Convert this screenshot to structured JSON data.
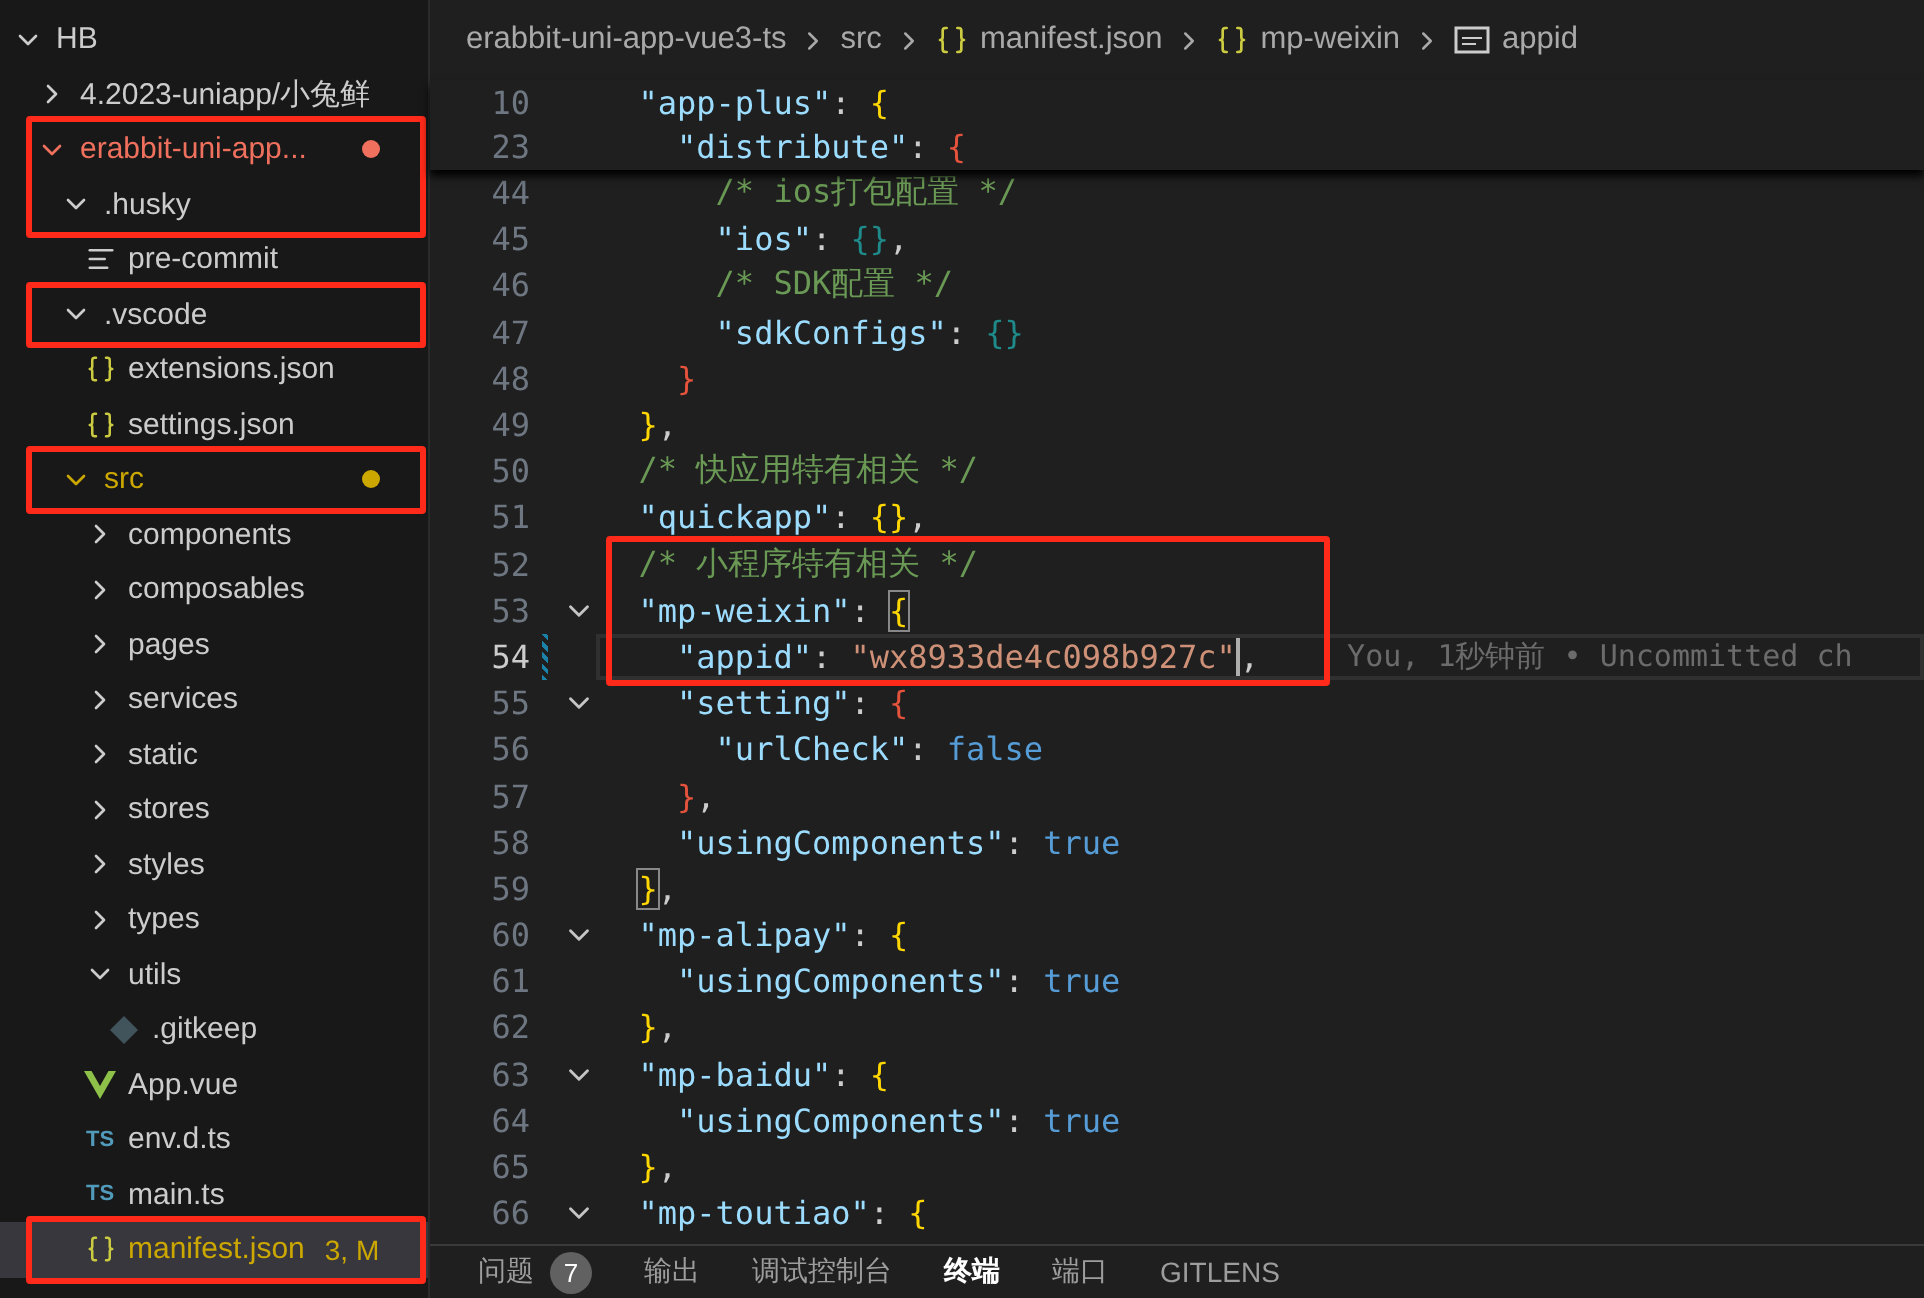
{
  "sidebar": {
    "tree": [
      {
        "label": "HB",
        "kind": "folder",
        "expanded": true,
        "selected": false,
        "children": [
          {
            "label": "4.2023-uniapp/小兔鲜",
            "kind": "folder",
            "expanded": false,
            "selected": false
          },
          {
            "label": "erabbit-uni-app...",
            "kind": "folder",
            "expanded": true,
            "selected": false,
            "color": "#f0705e",
            "dot": true,
            "annotated": true,
            "children": [
              {
                "label": ".husky",
                "kind": "folder",
                "expanded": true,
                "selected": false,
                "annotated": true,
                "children": [
                  {
                    "label": "pre-commit",
                    "kind": "lines",
                    "selected": false
                  }
                ]
              },
              {
                "label": ".vscode",
                "kind": "folder",
                "expanded": true,
                "selected": false,
                "annotated": true,
                "children": [
                  {
                    "label": "extensions.json",
                    "kind": "json",
                    "selected": false
                  },
                  {
                    "label": "settings.json",
                    "kind": "json",
                    "selected": false
                  }
                ]
              },
              {
                "label": "src",
                "kind": "folder",
                "expanded": true,
                "selected": false,
                "color": "#cca700",
                "dot": true,
                "annotated": true,
                "children": [
                  {
                    "label": "components",
                    "kind": "folder",
                    "expanded": false,
                    "selected": false
                  },
                  {
                    "label": "composables",
                    "kind": "folder",
                    "expanded": false,
                    "selected": false
                  },
                  {
                    "label": "pages",
                    "kind": "folder",
                    "expanded": false,
                    "selected": false
                  },
                  {
                    "label": "services",
                    "kind": "folder",
                    "expanded": false,
                    "selected": false
                  },
                  {
                    "label": "static",
                    "kind": "folder",
                    "expanded": false,
                    "selected": false
                  },
                  {
                    "label": "stores",
                    "kind": "folder",
                    "expanded": false,
                    "selected": false
                  },
                  {
                    "label": "styles",
                    "kind": "folder",
                    "expanded": false,
                    "selected": false
                  },
                  {
                    "label": "types",
                    "kind": "folder",
                    "expanded": false,
                    "selected": false
                  },
                  {
                    "label": "utils",
                    "kind": "folder",
                    "expanded": true,
                    "selected": false,
                    "children": [
                      {
                        "label": ".gitkeep",
                        "kind": "git",
                        "selected": false
                      }
                    ]
                  },
                  {
                    "label": "App.vue",
                    "kind": "vue",
                    "selected": false
                  },
                  {
                    "label": "env.d.ts",
                    "kind": "ts",
                    "icon_label": "TS",
                    "selected": false
                  },
                  {
                    "label": "main.ts",
                    "kind": "ts",
                    "icon_label": "TS",
                    "selected": false
                  },
                  {
                    "label": "manifest.json",
                    "kind": "json",
                    "selected": true,
                    "color": "#cca700",
                    "badge": "3, M",
                    "annotated": true
                  }
                ]
              }
            ]
          }
        ]
      }
    ]
  },
  "breadcrumb": [
    {
      "label": "erabbit-uni-app-vue3-ts",
      "kind": "plain"
    },
    {
      "label": "src",
      "kind": "plain"
    },
    {
      "label": "manifest.json",
      "kind": "object"
    },
    {
      "label": "mp-weixin",
      "kind": "object"
    },
    {
      "label": "appid",
      "kind": "string"
    }
  ],
  "sticky_lines": [
    {
      "number": "10",
      "tokens": [
        {
          "kind": "key",
          "text": "  \"app-plus\""
        },
        {
          "kind": "punct",
          "text": ": "
        },
        {
          "kind": "brace",
          "color": "#ffd700",
          "text": "{"
        }
      ]
    },
    {
      "number": "23",
      "tokens": [
        {
          "kind": "key",
          "text": "    \"distribute\""
        },
        {
          "kind": "punct",
          "text": ": "
        },
        {
          "kind": "brace",
          "color": "#e5533d",
          "text": "{"
        }
      ]
    }
  ],
  "lines": [
    {
      "number": "44",
      "fold": false,
      "tokens": [
        {
          "kind": "comment",
          "text": "      /* ios打包配置 */"
        }
      ]
    },
    {
      "number": "45",
      "fold": false,
      "tokens": [
        {
          "kind": "key",
          "text": "      \"ios\""
        },
        {
          "kind": "punct",
          "text": ": "
        },
        {
          "kind": "brace",
          "color": "#1f8a8a",
          "text": "{}"
        },
        {
          "kind": "punct",
          "text": ","
        }
      ]
    },
    {
      "number": "46",
      "fold": false,
      "tokens": [
        {
          "kind": "comment",
          "text": "      /* SDK配置 */"
        }
      ]
    },
    {
      "number": "47",
      "fold": false,
      "tokens": [
        {
          "kind": "key",
          "text": "      \"sdkConfigs\""
        },
        {
          "kind": "punct",
          "text": ": "
        },
        {
          "kind": "brace",
          "color": "#1f8a8a",
          "text": "{}"
        }
      ]
    },
    {
      "number": "48",
      "fold": false,
      "tokens": [
        {
          "kind": "brace",
          "color": "#e5533d",
          "text": "    }"
        }
      ]
    },
    {
      "number": "49",
      "fold": false,
      "tokens": [
        {
          "kind": "brace",
          "color": "#ffd700",
          "text": "  }"
        },
        {
          "kind": "punct",
          "text": ","
        }
      ]
    },
    {
      "number": "50",
      "fold": false,
      "tokens": [
        {
          "kind": "comment",
          "text": "  /* 快应用特有相关 */"
        }
      ]
    },
    {
      "number": "51",
      "fold": false,
      "tokens": [
        {
          "kind": "key",
          "text": "  \"quickapp\""
        },
        {
          "kind": "punct",
          "text": ": "
        },
        {
          "kind": "brace",
          "color": "#ffd700",
          "text": "{}"
        },
        {
          "kind": "punct",
          "text": ","
        }
      ]
    },
    {
      "number": "52",
      "fold": false,
      "annotated": true,
      "tokens": [
        {
          "kind": "comment",
          "text": "  /* 小程序特有相关 */"
        }
      ]
    },
    {
      "number": "53",
      "fold": true,
      "annotated": true,
      "tokens": [
        {
          "kind": "key",
          "text": "  \"mp-weixin\""
        },
        {
          "kind": "punct",
          "text": ": "
        },
        {
          "kind": "brace",
          "color": "#ffd700",
          "text": "{",
          "matched": true
        }
      ]
    },
    {
      "number": "54",
      "fold": false,
      "annotated": true,
      "current": true,
      "modified": true,
      "tokens": [
        {
          "kind": "key",
          "text": "    \"appid\""
        },
        {
          "kind": "punct",
          "text": ": "
        },
        {
          "kind": "string",
          "text": "\"wx8933de4c098b927c"
        },
        {
          "kind": "cursor",
          "text": "\""
        },
        {
          "kind": "punct",
          "text": ","
        }
      ],
      "blame": "You, 1秒钟前 • Uncommitted ch"
    },
    {
      "number": "55",
      "fold": true,
      "tokens": [
        {
          "kind": "key",
          "text": "    \"setting\""
        },
        {
          "kind": "punct",
          "text": ": "
        },
        {
          "kind": "brace",
          "color": "#e5533d",
          "text": "{"
        }
      ]
    },
    {
      "number": "56",
      "fold": false,
      "tokens": [
        {
          "kind": "key",
          "text": "      \"urlCheck\""
        },
        {
          "kind": "punct",
          "text": ": "
        },
        {
          "kind": "bool",
          "text": "false"
        }
      ]
    },
    {
      "number": "57",
      "fold": false,
      "tokens": [
        {
          "kind": "brace",
          "color": "#e5533d",
          "text": "    }"
        },
        {
          "kind": "punct",
          "text": ","
        }
      ]
    },
    {
      "number": "58",
      "fold": false,
      "tokens": [
        {
          "kind": "key",
          "text": "    \"usingComponents\""
        },
        {
          "kind": "punct",
          "text": ": "
        },
        {
          "kind": "bool",
          "text": "true"
        }
      ]
    },
    {
      "number": "59",
      "fold": false,
      "tokens": [
        {
          "kind": "brace",
          "color": "#ffd700",
          "text": "  }",
          "matched": true
        },
        {
          "kind": "punct",
          "text": ","
        }
      ]
    },
    {
      "number": "60",
      "fold": true,
      "tokens": [
        {
          "kind": "key",
          "text": "  \"mp-alipay\""
        },
        {
          "kind": "punct",
          "text": ": "
        },
        {
          "kind": "brace",
          "color": "#ffd700",
          "text": "{"
        }
      ]
    },
    {
      "number": "61",
      "fold": false,
      "tokens": [
        {
          "kind": "key",
          "text": "    \"usingComponents\""
        },
        {
          "kind": "punct",
          "text": ": "
        },
        {
          "kind": "bool",
          "text": "true"
        }
      ]
    },
    {
      "number": "62",
      "fold": false,
      "tokens": [
        {
          "kind": "brace",
          "color": "#ffd700",
          "text": "  }"
        },
        {
          "kind": "punct",
          "text": ","
        }
      ]
    },
    {
      "number": "63",
      "fold": true,
      "tokens": [
        {
          "kind": "key",
          "text": "  \"mp-baidu\""
        },
        {
          "kind": "punct",
          "text": ": "
        },
        {
          "kind": "brace",
          "color": "#ffd700",
          "text": "{"
        }
      ]
    },
    {
      "number": "64",
      "fold": false,
      "tokens": [
        {
          "kind": "key",
          "text": "    \"usingComponents\""
        },
        {
          "kind": "punct",
          "text": ": "
        },
        {
          "kind": "bool",
          "text": "true"
        }
      ]
    },
    {
      "number": "65",
      "fold": false,
      "tokens": [
        {
          "kind": "brace",
          "color": "#ffd700",
          "text": "  }"
        },
        {
          "kind": "punct",
          "text": ","
        }
      ]
    },
    {
      "number": "66",
      "fold": true,
      "tokens": [
        {
          "kind": "key",
          "text": "  \"mp-toutiao\""
        },
        {
          "kind": "punct",
          "text": ": "
        },
        {
          "kind": "brace",
          "color": "#ffd700",
          "text": "{"
        }
      ]
    }
  ],
  "panel_tabs": [
    {
      "label": "问题",
      "badge": "7",
      "selected": false
    },
    {
      "label": "输出",
      "selected": false
    },
    {
      "label": "调试控制台",
      "selected": false
    },
    {
      "label": "终端",
      "selected": true
    },
    {
      "label": "端口",
      "selected": false
    },
    {
      "label": "GITLENS",
      "selected": false
    }
  ]
}
